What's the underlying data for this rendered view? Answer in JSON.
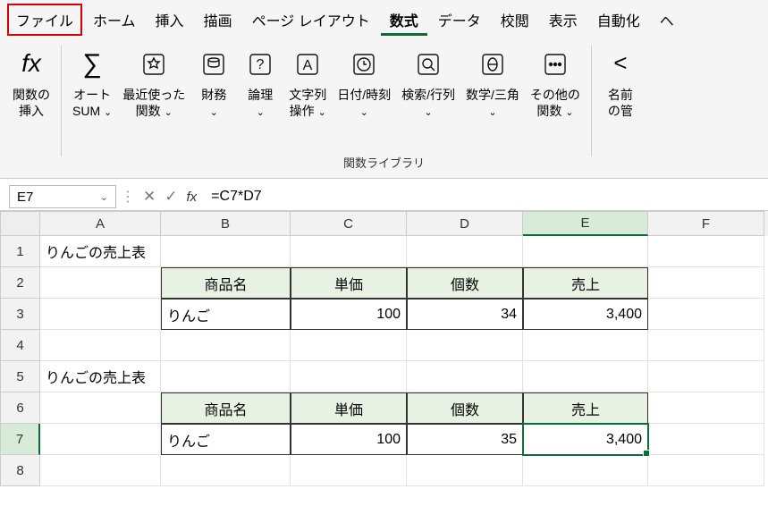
{
  "menu": {
    "file": "ファイル",
    "home": "ホーム",
    "insert": "挿入",
    "draw": "描画",
    "layout": "ページ レイアウト",
    "formulas": "数式",
    "data": "データ",
    "review": "校閲",
    "view": "表示",
    "auto": "自動化",
    "help_prefix": "ヘ"
  },
  "ribbon": {
    "insert_function": "関数の\n挿入",
    "autosum": "オート\nSUM",
    "recent": "最近使った\n関数",
    "financial": "財務",
    "logical": "論理",
    "text": "文字列\n操作",
    "datetime": "日付/時刻",
    "lookup": "検索/行列",
    "math": "数学/三角",
    "more": "その他の\n関数",
    "name_mgr": "名前\nの管",
    "group_label": "関数ライブラリ"
  },
  "namebox": "E7",
  "formula": "=C7*D7",
  "cols": [
    "A",
    "B",
    "C",
    "D",
    "E",
    "F"
  ],
  "rows": {
    "r1": {
      "A": "りんごの売上表"
    },
    "r2": {
      "B": "商品名",
      "C": "単価",
      "D": "個数",
      "E": "売上"
    },
    "r3": {
      "B": "りんご",
      "C": "100",
      "D": "34",
      "E": "3,400"
    },
    "r5": {
      "A": "りんごの売上表"
    },
    "r6": {
      "B": "商品名",
      "C": "単価",
      "D": "個数",
      "E": "売上"
    },
    "r7": {
      "B": "りんご",
      "C": "100",
      "D": "35",
      "E": "3,400"
    }
  }
}
